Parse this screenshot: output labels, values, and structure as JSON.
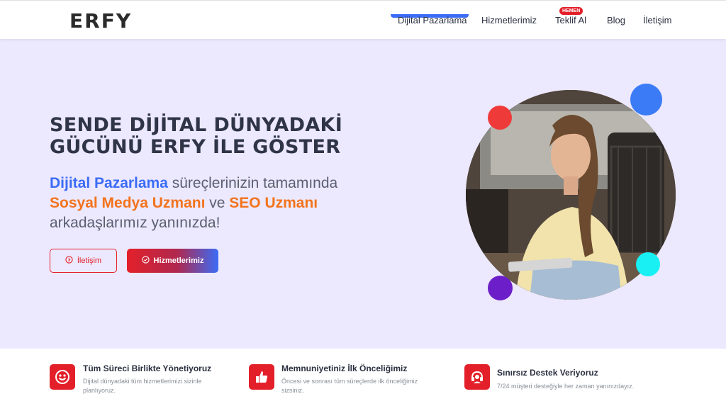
{
  "brand": {
    "logo": "ERFY"
  },
  "nav": {
    "items": [
      {
        "label": "Dijital Pazarlama",
        "active": true
      },
      {
        "label": "Hizmetlerimiz"
      },
      {
        "label": "Teklif Al",
        "badge": "HEMEN"
      },
      {
        "label": "Blog"
      },
      {
        "label": "İletişim"
      }
    ]
  },
  "hero": {
    "title_line1": "SENDE DİJİTAL DÜNYADAKİ",
    "title_line2": "GÜCÜNÜ ERFY İLE GÖSTER",
    "sub": {
      "highlight1": "Dijital Pazarlama",
      "text1": " süreçlerinizin tamamında",
      "highlight2": "Sosyal Medya Uzmanı",
      "text2": " ve ",
      "highlight3": "SEO Uzmanı",
      "text3": "arkadaşlarımız yanınızda!"
    },
    "buttons": {
      "contact": "İletişim",
      "services": "Hizmetlerimiz"
    }
  },
  "features": [
    {
      "title": "Tüm Süreci Birlikte Yönetiyoruz",
      "desc": "Dijital dünyadaki tüm hizmetlerimizi sizinle planlıyoruz.",
      "icon": "smile-icon"
    },
    {
      "title": "Memnuniyetiniz İlk Önceliğimiz",
      "desc": "Öncesi ve sonrası tüm süreçlerde ilk önceliğimiz sizsiniz.",
      "icon": "thumbs-up-icon"
    },
    {
      "title": "Sınırsız Destek Veriyoruz",
      "desc": "7/24 müşteri desteğiyle her zaman yanınızdayız.",
      "icon": "support-headset-icon"
    }
  ],
  "colors": {
    "accent_red": "#e3202a",
    "accent_blue": "#3b6cf6",
    "accent_orange": "#f3731c",
    "hero_bg": "#ece8fd"
  }
}
